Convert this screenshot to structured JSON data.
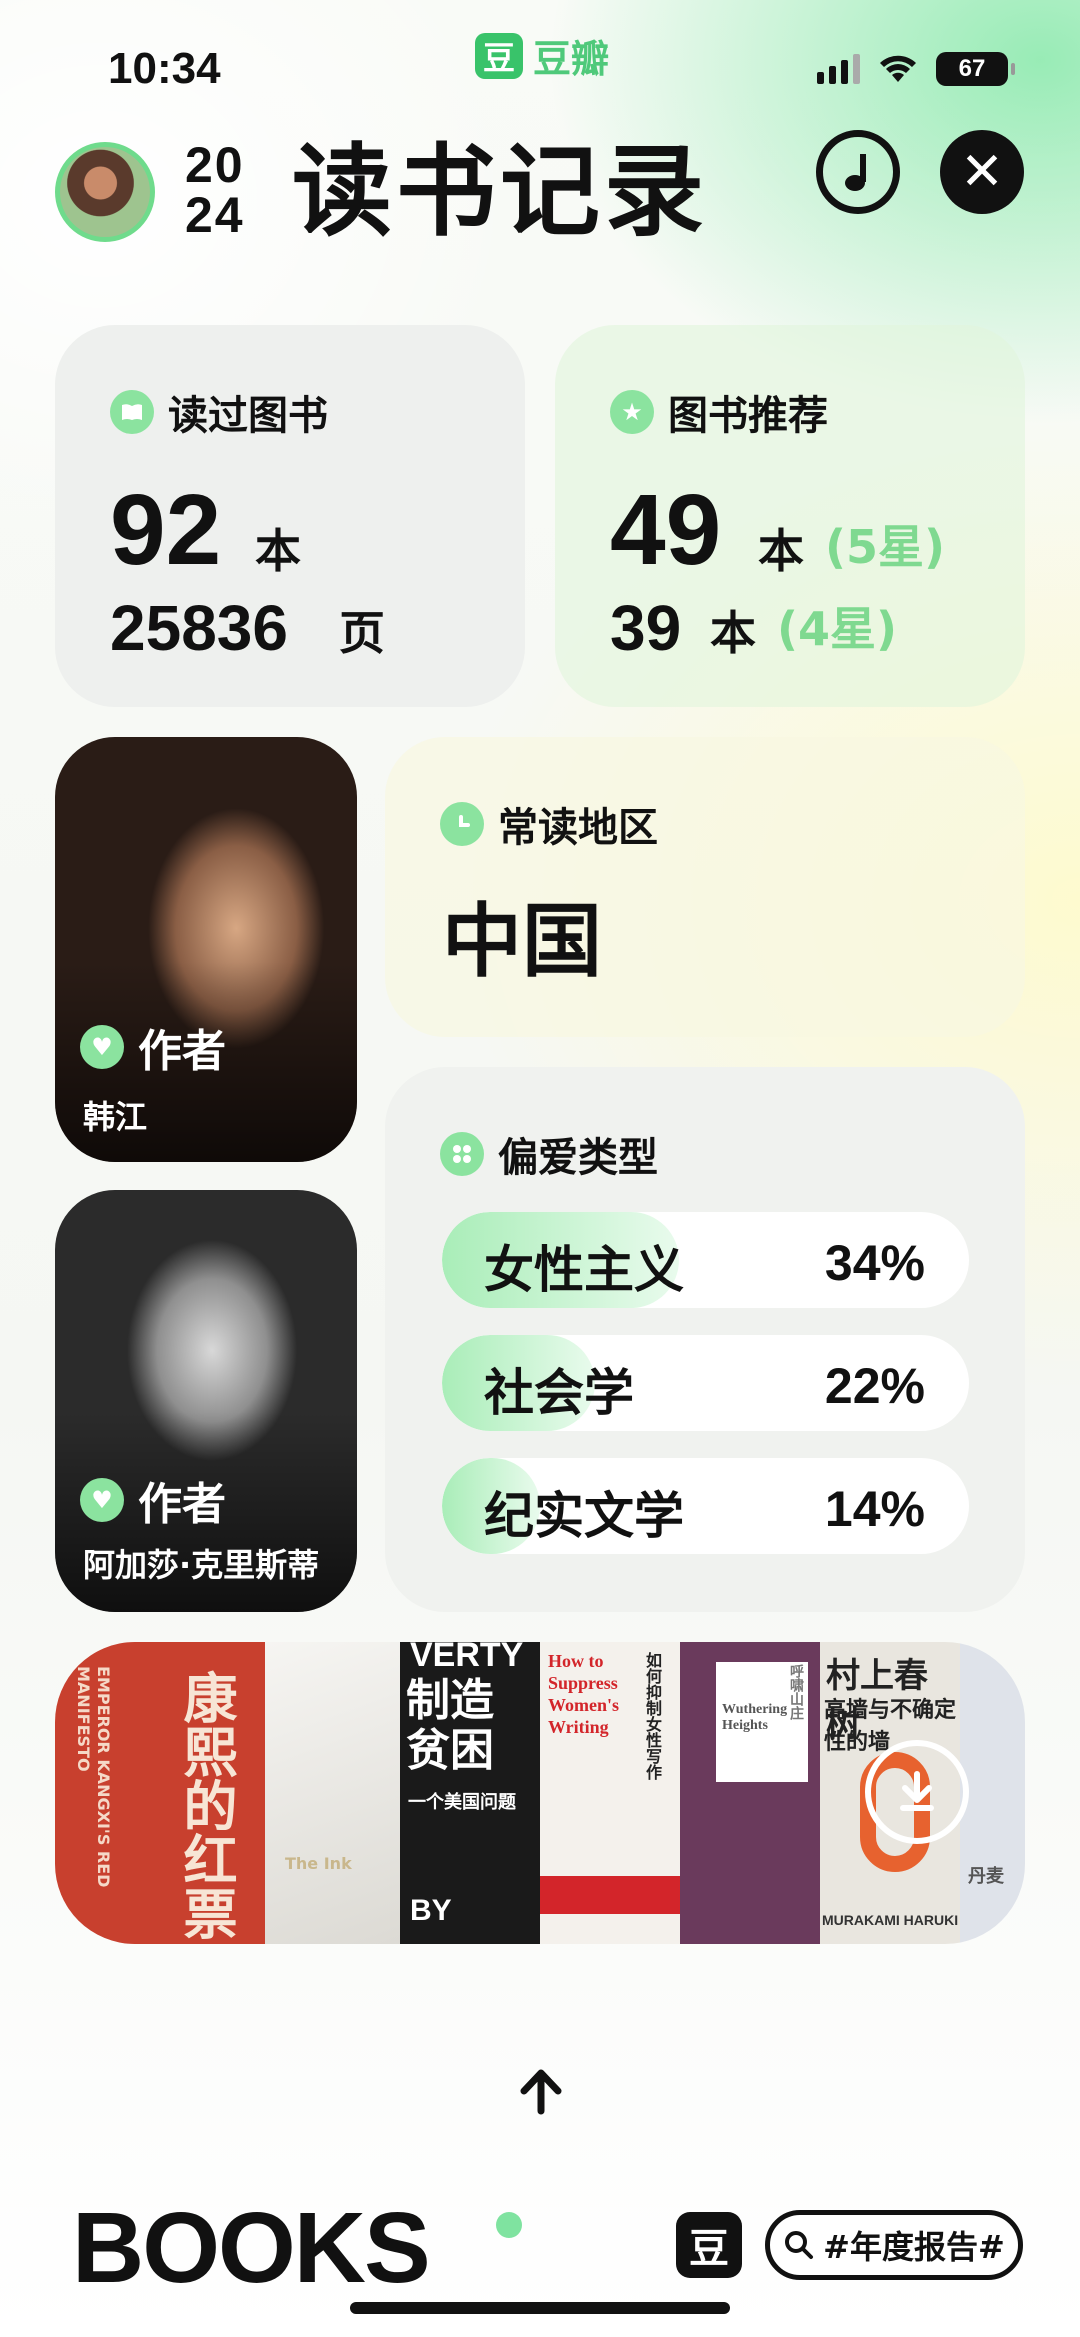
{
  "status_bar": {
    "time": "10:34",
    "battery": "67",
    "app_name": "豆瓣",
    "app_mark": "豆"
  },
  "header": {
    "year_top": "20",
    "year_bottom": "24",
    "title": "读书记录"
  },
  "books_read": {
    "label": "读过图书",
    "count": "92",
    "count_unit": "本",
    "pages": "25836",
    "pages_unit": "页"
  },
  "recommended": {
    "label": "图书推荐",
    "five_star_count": "49",
    "five_star_unit": "本",
    "five_star_label": "(5星)",
    "four_star_count": "39",
    "four_star_unit": "本",
    "four_star_label": "(4星)"
  },
  "region": {
    "label": "常读地区",
    "value": "中国"
  },
  "authors": [
    {
      "label": "作者",
      "name": "韩江"
    },
    {
      "label": "作者",
      "name": "阿加莎·克里斯蒂"
    }
  ],
  "genres": {
    "label": "偏爱类型",
    "items": [
      {
        "name": "女性主义",
        "percent": "34%",
        "fraction": 0.34
      },
      {
        "name": "社会学",
        "percent": "22%",
        "fraction": 0.22
      },
      {
        "name": "纪实文学",
        "percent": "14%",
        "fraction": 0.14
      }
    ]
  },
  "book_covers": [
    {
      "title": "康熙的红票",
      "subtitle": "EMPEROR KANGXI'S RED MANIFESTO",
      "color": "#c8402e"
    },
    {
      "title": "The Ink",
      "color": "#efeeea"
    },
    {
      "title": "制造贫困",
      "subtitle": "一个美国问题",
      "top": "VERTY",
      "bottom": "BY",
      "color": "#1a1a1a"
    },
    {
      "title": "How to Suppress Women's Writing",
      "subtitle": "如何抑制女性写作",
      "color": "#f4f1ec"
    },
    {
      "title": "Wuthering Heights",
      "subtitle": "呼啸山庄",
      "color": "#6a3a5c"
    },
    {
      "title": "村上春树",
      "subtitle": "高墙与不确定性的墙",
      "author": "MURAKAMI HARUKI",
      "color": "#e9e6df"
    },
    {
      "title": "丹麦",
      "color": "#dfe3ea"
    }
  ],
  "footer": {
    "brand": "BOOKS",
    "mark": "豆",
    "hashtag": "#年度报告#"
  }
}
